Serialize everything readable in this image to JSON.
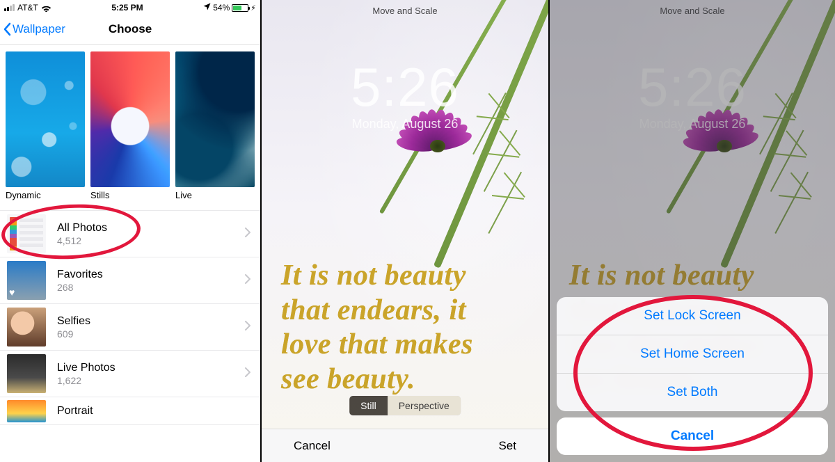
{
  "status": {
    "carrier": "AT&T",
    "time": "5:25 PM",
    "battery_pct": "54%"
  },
  "nav": {
    "back": "Wallpaper",
    "title": "Choose"
  },
  "categories": {
    "dynamic": "Dynamic",
    "stills": "Stills",
    "live": "Live"
  },
  "albums": [
    {
      "title": "All Photos",
      "count": "4,512"
    },
    {
      "title": "Favorites",
      "count": "268"
    },
    {
      "title": "Selfies",
      "count": "609"
    },
    {
      "title": "Live Photos",
      "count": "1,622"
    },
    {
      "title": "Portrait",
      "count": ""
    }
  ],
  "preview": {
    "header": "Move and Scale",
    "lock_time": "5:26",
    "lock_date": "Monday, August 26",
    "seg_still": "Still",
    "seg_perspective": "Perspective",
    "cancel": "Cancel",
    "set": "Set",
    "quote_l1": "It is not beauty",
    "quote_l2": "that endears, it",
    "quote_l3": "love that makes",
    "quote_l4": "see beauty."
  },
  "sheet": {
    "lock": "Set Lock Screen",
    "home": "Set Home Screen",
    "both": "Set Both",
    "cancel": "Cancel"
  }
}
